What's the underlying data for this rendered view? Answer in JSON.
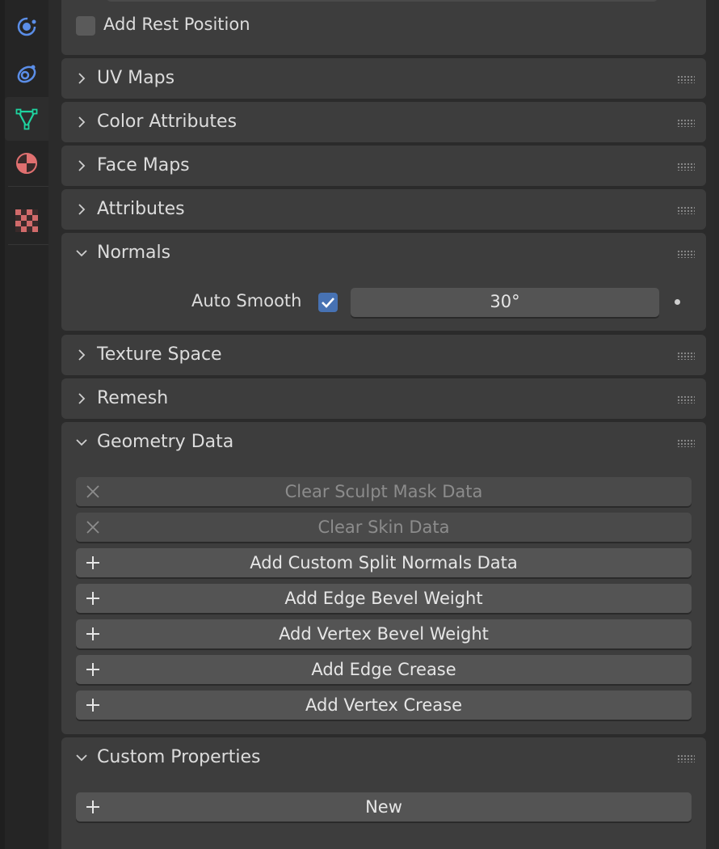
{
  "tabs": [
    {
      "id": "physics",
      "icon": "physics-orbit-icon"
    },
    {
      "id": "constraints",
      "icon": "object-constraint-icon"
    },
    {
      "id": "data",
      "icon": "mesh-data-icon",
      "active": true
    },
    {
      "id": "material",
      "icon": "material-sphere-icon"
    },
    {
      "id": "texture",
      "icon": "texture-checker-icon"
    }
  ],
  "shape_keys_tail": {
    "add_rest_position_label": "Add Rest Position",
    "add_rest_position_checked": false
  },
  "panels": {
    "uv_maps": "UV Maps",
    "color_attributes": "Color Attributes",
    "face_maps": "Face Maps",
    "attributes": "Attributes",
    "normals": "Normals",
    "texture_space": "Texture Space",
    "remesh": "Remesh",
    "geometry_data": "Geometry Data",
    "custom_properties": "Custom Properties"
  },
  "normals": {
    "auto_smooth_label": "Auto Smooth",
    "auto_smooth_checked": true,
    "angle": "30°"
  },
  "geometry_data": {
    "clear_sculpt_mask": "Clear Sculpt Mask Data",
    "clear_skin": "Clear Skin Data",
    "add_custom_split_normals": "Add Custom Split Normals Data",
    "add_edge_bevel_weight": "Add Edge Bevel Weight",
    "add_vertex_bevel_weight": "Add Vertex Bevel Weight",
    "add_edge_crease": "Add Edge Crease",
    "add_vertex_crease": "Add Vertex Crease"
  },
  "custom_properties": {
    "new_label": "New"
  },
  "colors": {
    "accent": "#4772b3",
    "data_tab": "#1fd4a0",
    "physics": "#5b8ee8",
    "material": "#e07070"
  }
}
